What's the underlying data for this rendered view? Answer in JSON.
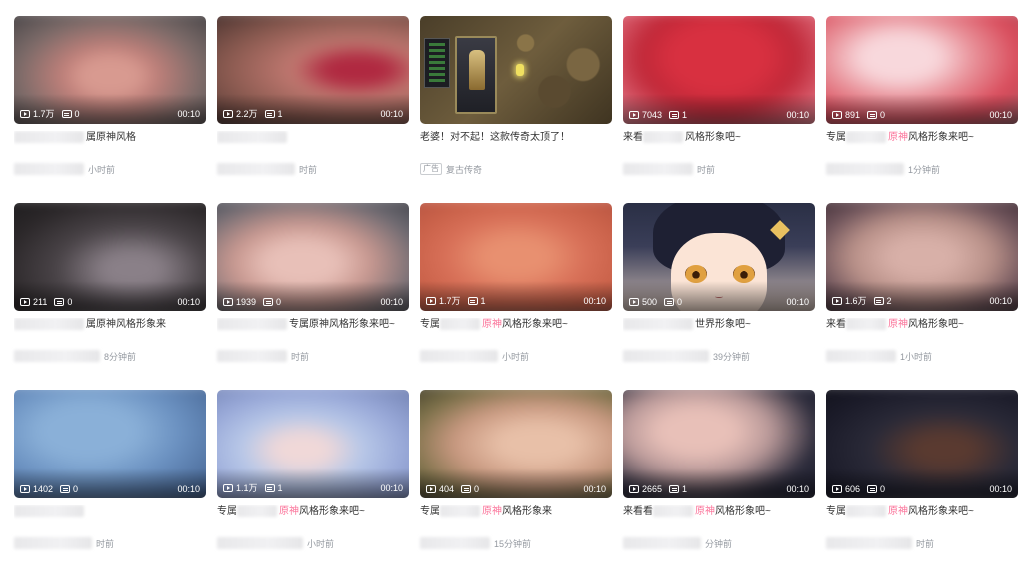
{
  "colors": {
    "highlight": "#fb7299",
    "meta": "#9499a0"
  },
  "videos": [
    {
      "plays": "1.7万",
      "danmaku": "0",
      "duration": "00:10",
      "title_pre": "",
      "title_hl": "",
      "title_post": "属原神风格",
      "meta": "小时前",
      "thumb": "radial-gradient(ellipse at 50% 55%, #d89a90 0 18%, #c0807a 30%, #7a6a68 60%, #3a3a3e 100%)"
    },
    {
      "plays": "2.2万",
      "danmaku": "1",
      "duration": "00:10",
      "title_pre": "",
      "title_hl": "",
      "title_post": "",
      "meta": "时前",
      "thumb": "radial-gradient(ellipse at 70% 50%, #b02840 0 14%, #c07870 30%, #8a5a50 60%, #3a2a28 100%)"
    },
    {
      "plays": "",
      "danmaku": "",
      "duration": "",
      "title_pre": "老婆！对不起！这款传奇太顶了！",
      "title_hl": "",
      "title_post": "",
      "meta": "复古传奇",
      "ad": "广告",
      "game": true
    },
    {
      "plays": "7043",
      "danmaku": "1",
      "duration": "00:10",
      "title_pre": "来看",
      "title_hl": "",
      "title_post": "风格形象吧~",
      "meta": "时前",
      "thumb": "radial-gradient(ellipse at 50% 40%, #d83040 0 30%, #c02838 50%, #e07080 80%, #f0a0a8 100%)"
    },
    {
      "plays": "891",
      "danmaku": "0",
      "duration": "00:10",
      "title_pre": "专属",
      "title_hl": "原神",
      "title_post": "风格形象来吧~",
      "meta": "1分钟前",
      "thumb": "radial-gradient(ellipse at 40% 40%, #f8d8dc 0 20%, #e89098 40%, #d84858 65%, #8a6a70 100%)"
    },
    {
      "plays": "211",
      "danmaku": "0",
      "duration": "00:10",
      "title_pre": "",
      "title_hl": "",
      "title_post": "属原神风格形象来",
      "meta": "8分钟前",
      "thumb": "radial-gradient(ellipse at 60% 60%, #8a8088 0 15%, #4a4448 40%, #2a2628 70%, #1a1a1c 100%)"
    },
    {
      "plays": "1939",
      "danmaku": "0",
      "duration": "00:10",
      "title_pre": "",
      "title_hl": "",
      "title_post": "专属原神风格形象来吧~",
      "meta": "时前",
      "thumb": "radial-gradient(ellipse at 45% 55%, #e8c0b8 0 20%, #c89890 40%, #6a6870 70%, #3a3a40 100%)"
    },
    {
      "plays": "1.7万",
      "danmaku": "1",
      "duration": "00:10",
      "title_pre": "专属",
      "title_hl": "原神",
      "title_post": "风格形象来吧~",
      "meta": "小时前",
      "thumb": "radial-gradient(ellipse at 50% 50%, #e89070 0 20%, #d87058 45%, #c86048 70%, #b05040 100%)"
    },
    {
      "plays": "500",
      "danmaku": "0",
      "duration": "00:10",
      "title_pre": "",
      "title_hl": "",
      "title_post": "世界形象吧~",
      "meta": "39分钟前",
      "anime": true
    },
    {
      "plays": "1.6万",
      "danmaku": "2",
      "duration": "00:10",
      "title_pre": "来看",
      "title_hl": "原神",
      "title_post": "风格形象吧~",
      "meta": "1小时前",
      "thumb": "radial-gradient(ellipse at 50% 50%, #d8b0a8 0 20%, #b89088 45%, #6a5058 70%, #3a2a30 100%)"
    },
    {
      "plays": "1402",
      "danmaku": "0",
      "duration": "00:10",
      "title_pre": "",
      "title_hl": "",
      "title_post": "",
      "meta": "时前",
      "thumb": "radial-gradient(ellipse at 40% 40%, #8ab0d8 0 25%, #6a90c0 50%, #4a6a98 80%, #2a3a5a 100%)"
    },
    {
      "plays": "1.1万",
      "danmaku": "1",
      "duration": "00:10",
      "title_pre": "专属",
      "title_hl": "原神",
      "title_post": "风格形象来吧~",
      "meta": "小时前",
      "thumb": "radial-gradient(ellipse at 45% 55%, #f0d8d8 0 15%, #b8c8e8 35%, #98a8d8 60%, #6878a8 100%)"
    },
    {
      "plays": "404",
      "danmaku": "0",
      "duration": "00:10",
      "title_pre": "专属",
      "title_hl": "原神",
      "title_post": "风格形象来",
      "meta": "15分钟前",
      "thumb": "radial-gradient(ellipse at 60% 50%, #e8c0a8 0 20%, #c89880 45%, #7a7048 70%, #3a3428 100%)"
    },
    {
      "plays": "2665",
      "danmaku": "1",
      "duration": "00:10",
      "title_pre": "来看看",
      "title_hl": "原神",
      "title_post": "风格形象吧~",
      "meta": "分钟前",
      "thumb": "radial-gradient(ellipse at 40% 40%, #e8c0b8 0 20%, #b89898 40%, #2a2a3a 65%, #1a1a2a 100%)"
    },
    {
      "plays": "606",
      "danmaku": "0",
      "duration": "00:10",
      "title_pre": "专属",
      "title_hl": "原神",
      "title_post": "风格形象来吧~",
      "meta": "时前",
      "thumb": "radial-gradient(ellipse at 60% 55%, #5a3a30 0 15%, #2a2a38 40%, #1a1a28 70%, #101018 100%)"
    }
  ]
}
